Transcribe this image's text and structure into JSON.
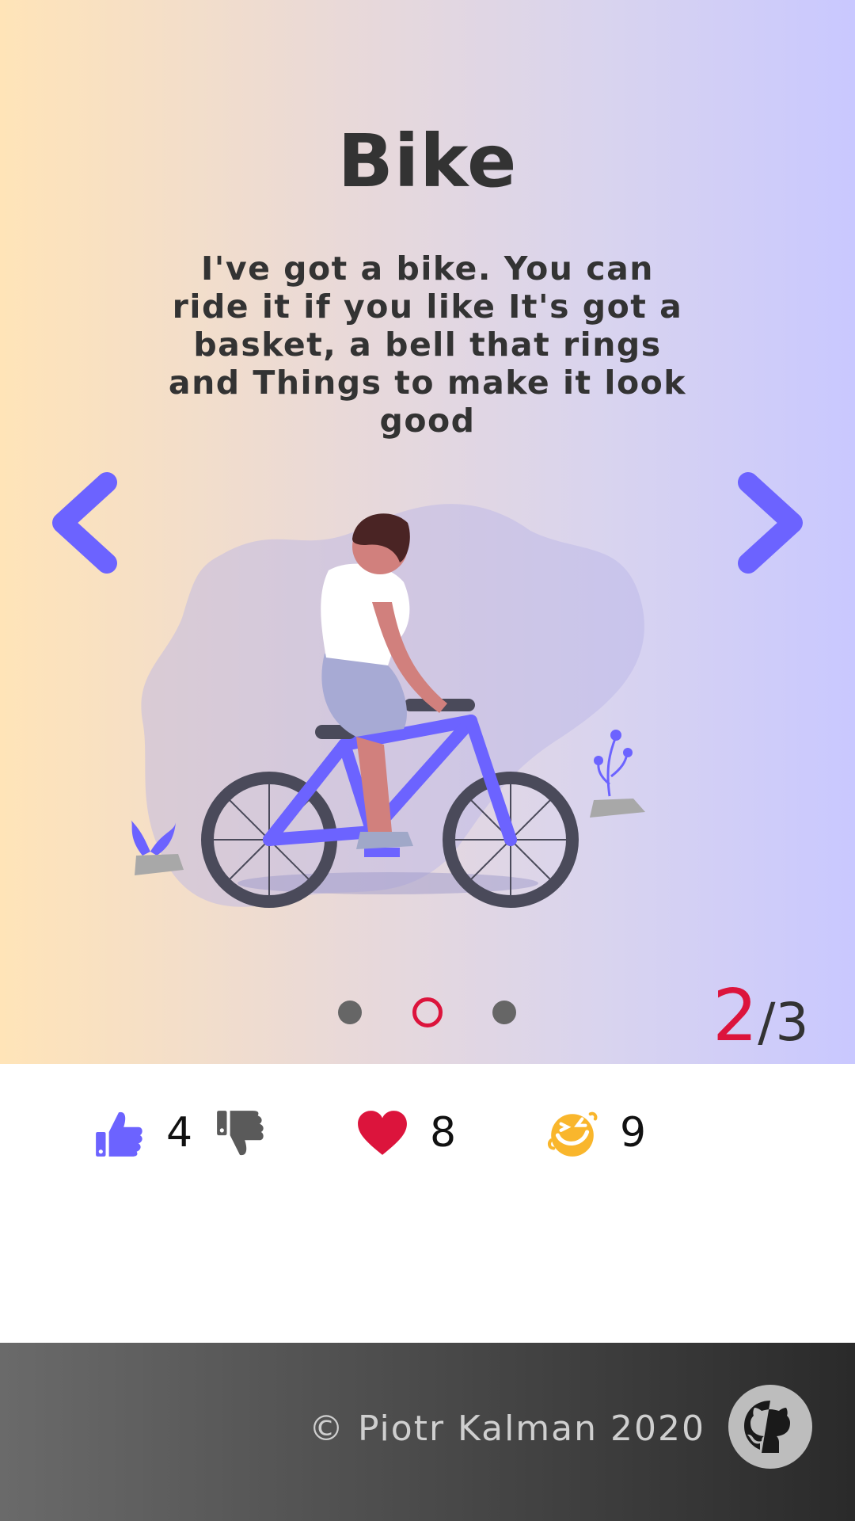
{
  "slide": {
    "title": "Bike",
    "description": "I've got a bike. You can ride it if you like It's got a basket, a bell that rings and Things to make it look good",
    "current": "2",
    "separator": "/",
    "total": "3"
  },
  "navigation": {
    "prev_icon": "chevron-left-icon",
    "next_icon": "chevron-right-icon",
    "dots_count": 3,
    "active_dot": 2
  },
  "reactions": {
    "likes": "4",
    "hearts": "8",
    "laughs": "9"
  },
  "footer": {
    "copyright": "© Piotr Kalman 2020",
    "github_icon": "github-icon"
  },
  "colors": {
    "accent": "#6c63ff",
    "highlight": "#dc143c",
    "laugh": "#f9b62c",
    "text": "#333333"
  }
}
